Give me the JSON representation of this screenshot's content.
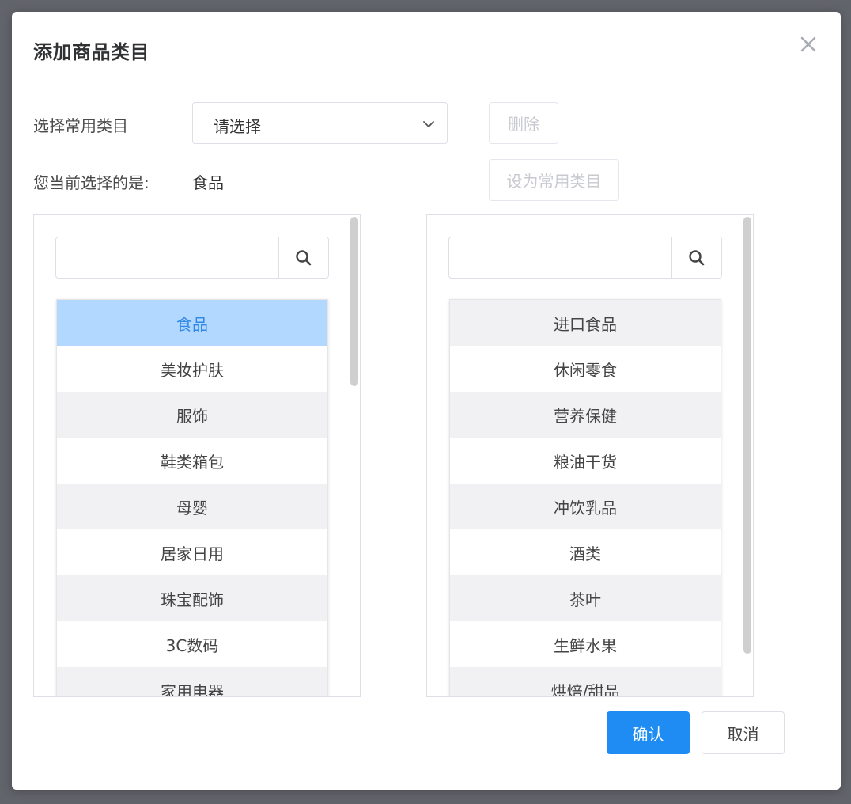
{
  "dialog": {
    "title": "添加商品类目",
    "close_icon": "close-icon"
  },
  "common_category": {
    "label": "选择常用类目",
    "select_value": "请选择",
    "delete_label": "删除"
  },
  "current_selection": {
    "label": "您当前选择的是:",
    "value": "食品",
    "set_common_label": "设为常用类目"
  },
  "left_panel": {
    "search_value": "",
    "search_icon": "search-icon",
    "items": [
      {
        "label": "食品",
        "selected": true
      },
      {
        "label": "美妆护肤",
        "selected": false
      },
      {
        "label": "服饰",
        "selected": false
      },
      {
        "label": "鞋类箱包",
        "selected": false
      },
      {
        "label": "母婴",
        "selected": false
      },
      {
        "label": "居家日用",
        "selected": false
      },
      {
        "label": "珠宝配饰",
        "selected": false
      },
      {
        "label": "3C数码",
        "selected": false
      },
      {
        "label": "家用电器",
        "selected": false
      }
    ]
  },
  "right_panel": {
    "search_value": "",
    "search_icon": "search-icon",
    "items": [
      {
        "label": "进口食品"
      },
      {
        "label": "休闲零食"
      },
      {
        "label": "营养保健"
      },
      {
        "label": "粮油干货"
      },
      {
        "label": "冲饮乳品"
      },
      {
        "label": "酒类"
      },
      {
        "label": "茶叶"
      },
      {
        "label": "生鲜水果"
      },
      {
        "label": "烘焙/甜品"
      }
    ]
  },
  "footer": {
    "confirm_label": "确认",
    "cancel_label": "取消"
  },
  "colors": {
    "primary": "#1e8cf2",
    "selected_bg": "#b3d8ff",
    "selected_text": "#2f88e6",
    "stripe": "#f1f1f4"
  }
}
